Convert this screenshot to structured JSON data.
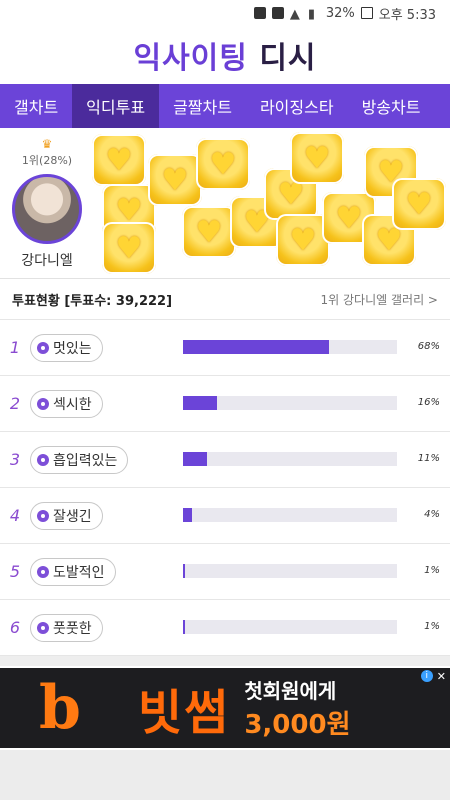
{
  "status_bar": {
    "battery": "32%",
    "time": "오후 5:33"
  },
  "header": {
    "logo_part1": "익사이팅",
    "logo_part2": "디시"
  },
  "tabs": [
    {
      "label": "갤차트",
      "active": false
    },
    {
      "label": "익디투표",
      "active": true
    },
    {
      "label": "글짤차트",
      "active": false
    },
    {
      "label": "라이징스타",
      "active": false
    },
    {
      "label": "방송차트",
      "active": false
    }
  ],
  "rank1": {
    "label": "1위(28%)",
    "name": "강다니엘"
  },
  "vote": {
    "title": "투표현황 [투표수: 39,222]",
    "gallery_link": "1위 강다니엘 갤러리 >"
  },
  "items": [
    {
      "rank": "1",
      "label": "멋있는",
      "percent_text": "68%",
      "percent": 68
    },
    {
      "rank": "2",
      "label": "섹시한",
      "percent_text": "16%",
      "percent": 16
    },
    {
      "rank": "3",
      "label": "흡입력있는",
      "percent_text": "11%",
      "percent": 11
    },
    {
      "rank": "4",
      "label": "잘생긴",
      "percent_text": "4%",
      "percent": 4
    },
    {
      "rank": "5",
      "label": "도발적인",
      "percent_text": "1%",
      "percent": 1
    },
    {
      "rank": "6",
      "label": "풋풋한",
      "percent_text": "1%",
      "percent": 1
    }
  ],
  "ad": {
    "brand": "빗썸",
    "line1": "첫회원에게",
    "line2": "3,000원"
  },
  "colors": {
    "accent": "#6b44d8",
    "tab_active": "#4b2b9c",
    "ad_orange": "#ff6a0a"
  }
}
